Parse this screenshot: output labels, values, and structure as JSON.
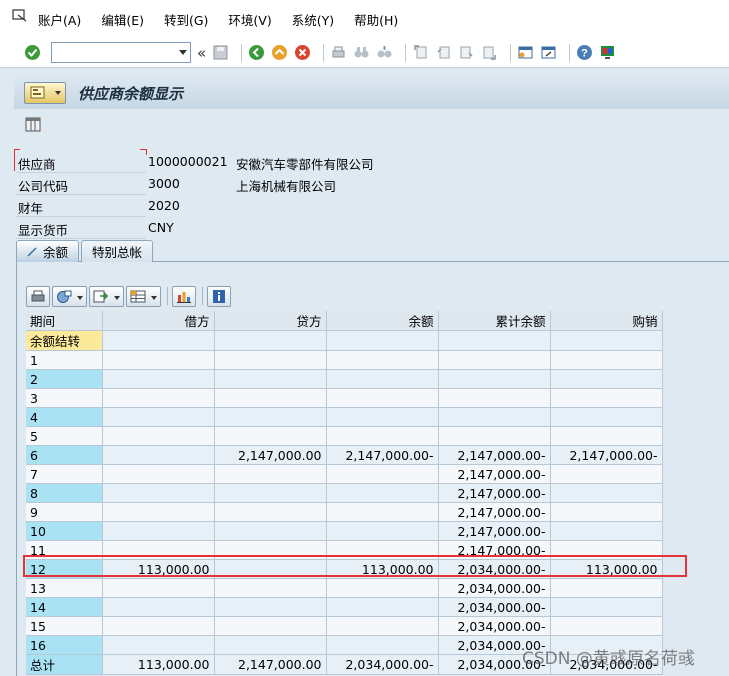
{
  "menu": {
    "items": [
      {
        "label": "账户(A)"
      },
      {
        "label": "编辑(E)"
      },
      {
        "label": "转到(G)"
      },
      {
        "label": "环境(V)"
      },
      {
        "label": "系统(Y)"
      },
      {
        "label": "帮助(H)"
      }
    ]
  },
  "toolbar": {
    "command_value": "",
    "collapse_glyph": "«"
  },
  "title": "供应商余额显示",
  "header": {
    "fields": [
      {
        "label": "供应商",
        "value": "1000000021",
        "desc": "安徽汽车零部件有限公司"
      },
      {
        "label": "公司代码",
        "value": "3000",
        "desc": "上海机械有限公司"
      },
      {
        "label": "财年",
        "value": "2020",
        "desc": ""
      },
      {
        "label": "显示货币",
        "value": "CNY",
        "desc": ""
      }
    ]
  },
  "tabs": [
    {
      "label": "余额"
    },
    {
      "label": "特别总帐"
    }
  ],
  "grid": {
    "columns": [
      "期间",
      "借方",
      "贷方",
      "余额",
      "累计余额",
      "购销"
    ],
    "rows": [
      [
        "余额结转",
        "",
        "",
        "",
        "",
        ""
      ],
      [
        "1",
        "",
        "",
        "",
        "",
        ""
      ],
      [
        "2",
        "",
        "",
        "",
        "",
        ""
      ],
      [
        "3",
        "",
        "",
        "",
        "",
        ""
      ],
      [
        "4",
        "",
        "",
        "",
        "",
        ""
      ],
      [
        "5",
        "",
        "",
        "",
        "",
        ""
      ],
      [
        "6",
        "",
        "2,147,000.00",
        "2,147,000.00-",
        "2,147,000.00-",
        "2,147,000.00-"
      ],
      [
        "7",
        "",
        "",
        "",
        "2,147,000.00-",
        ""
      ],
      [
        "8",
        "",
        "",
        "",
        "2,147,000.00-",
        ""
      ],
      [
        "9",
        "",
        "",
        "",
        "2,147,000.00-",
        ""
      ],
      [
        "10",
        "",
        "",
        "",
        "2,147,000.00-",
        ""
      ],
      [
        "11",
        "",
        "",
        "",
        "2,147,000.00-",
        ""
      ],
      [
        "12",
        "113,000.00",
        "",
        "113,000.00",
        "2,034,000.00-",
        "113,000.00"
      ],
      [
        "13",
        "",
        "",
        "",
        "2,034,000.00-",
        ""
      ],
      [
        "14",
        "",
        "",
        "",
        "2,034,000.00-",
        ""
      ],
      [
        "15",
        "",
        "",
        "",
        "2,034,000.00-",
        ""
      ],
      [
        "16",
        "",
        "",
        "",
        "2,034,000.00-",
        ""
      ],
      [
        "总计",
        "113,000.00",
        "2,147,000.00",
        "2,034,000.00-",
        "2,034,000.00-",
        "2,034,000.00-"
      ]
    ]
  },
  "watermark": "CSDN @黄彧原名荷彧",
  "colors": {
    "accent_red": "#e6323b",
    "key_column": "#a8e2f3",
    "selected_cell": "#fde99a"
  }
}
